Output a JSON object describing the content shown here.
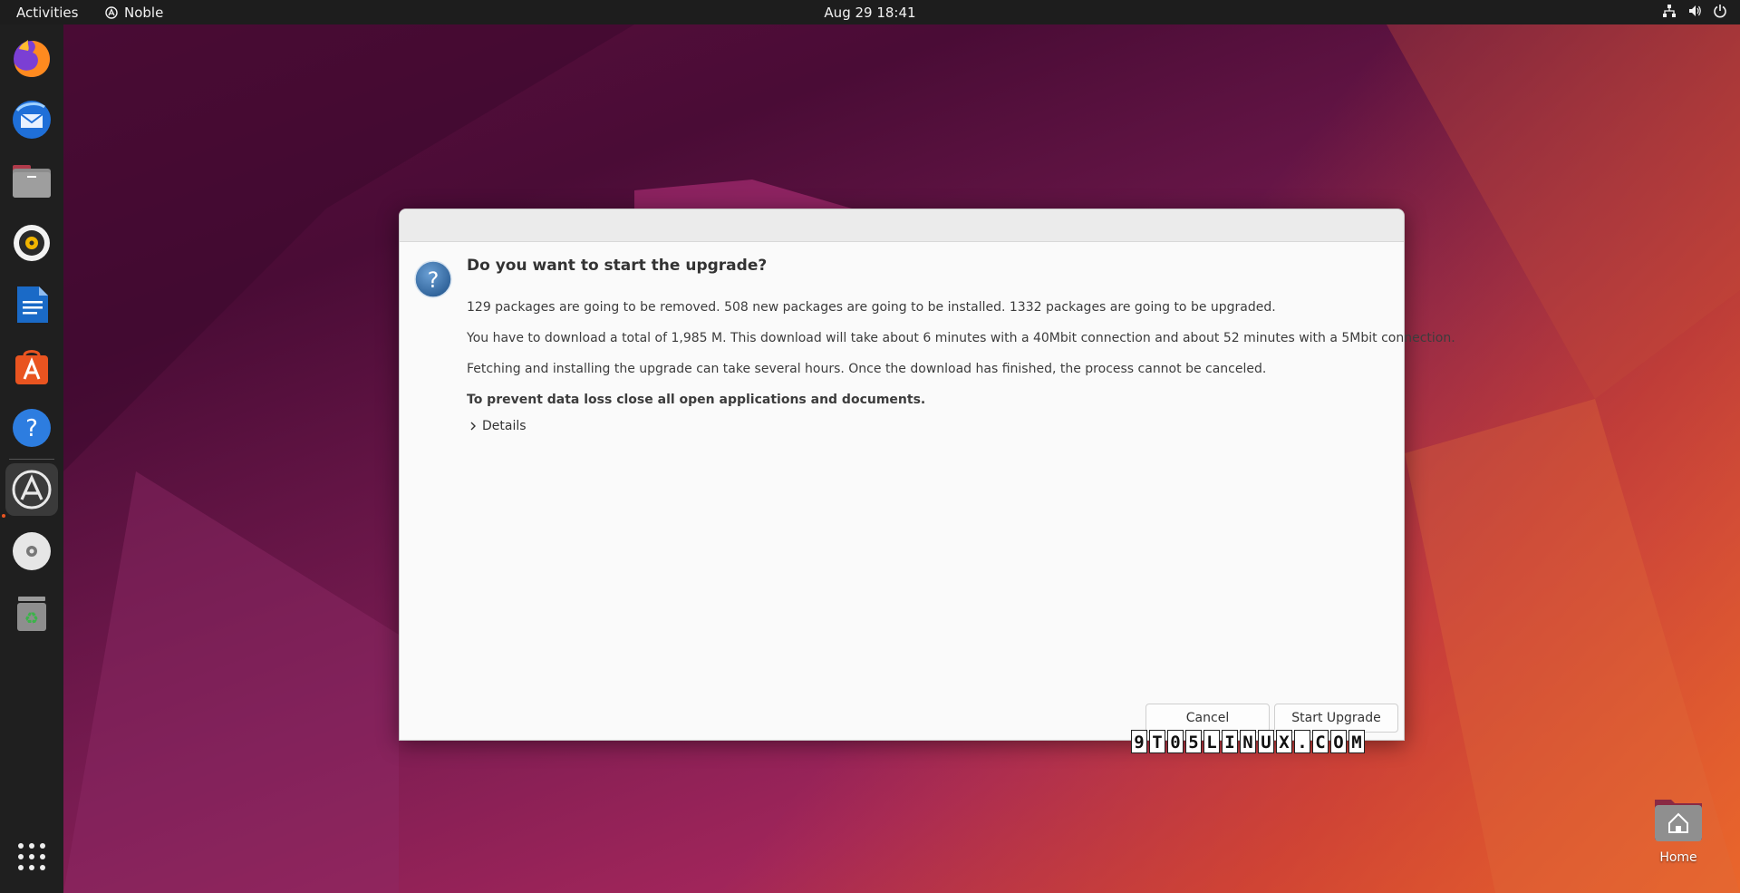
{
  "topbar": {
    "activities": "Activities",
    "app_name": "Noble",
    "clock": "Aug 29  18:41"
  },
  "dock": {
    "apps": [
      "firefox-icon",
      "thunderbird-icon",
      "files-icon",
      "rhythmbox-icon",
      "writer-icon",
      "app-center-icon",
      "help-icon",
      "software-updater-icon",
      "disc-icon",
      "trash-icon",
      "show-apps-icon"
    ]
  },
  "dialog": {
    "heading": "Do you want to start the upgrade?",
    "line1": "129 packages are going to be removed. 508 new packages are going to be installed. 1332 packages are going to be upgraded.",
    "line2": "You have to download a total of 1,985 M. This download will take about 6 minutes with a 40Mbit connection and about 52 minutes with a 5Mbit connection.",
    "line3": "Fetching and installing the upgrade can take several hours. Once the download has finished, the process cannot be canceled.",
    "warning": "To prevent data loss close all open applications and documents.",
    "details_label": "Details",
    "cancel_label": "Cancel",
    "start_label": "Start Upgrade"
  },
  "watermark": [
    "9",
    "T",
    "0",
    "5",
    "L",
    "I",
    "N",
    "U",
    "X",
    ".",
    "C",
    "O",
    "M"
  ],
  "desktop": {
    "home_label": "Home"
  },
  "colors": {
    "accent": "#e95420",
    "topbar_bg": "#1d1d1d",
    "dock_bg": "#1f1f1f",
    "dialog_bg": "#fafafa"
  }
}
